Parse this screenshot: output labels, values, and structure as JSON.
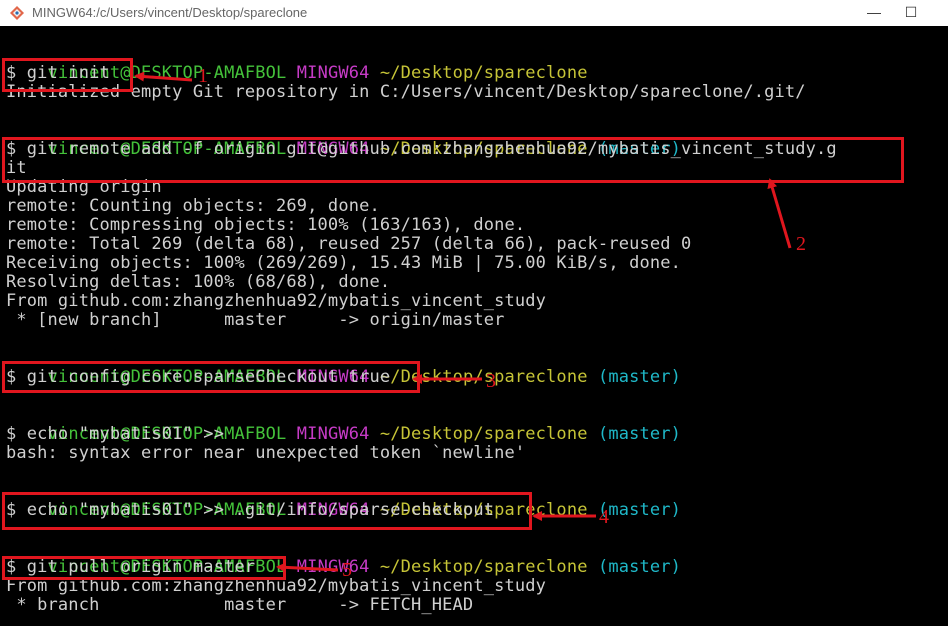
{
  "window": {
    "title": "MINGW64:/c/Users/vincent/Desktop/spareclone",
    "icon": "git-bash-icon",
    "minimize_glyph": "—",
    "maximize_glyph": "☐"
  },
  "colors": {
    "user": "#44c23a",
    "shell": "#c63bc6",
    "path": "#c6c437",
    "branch": "#1fb8c8",
    "text": "#d0d0d0",
    "annotation": "#e0161e"
  },
  "terminal": {
    "prompts": [
      {
        "user": "vincent@DESKTOP-AMAFBOL",
        "shell": "MINGW64",
        "path": "~/Desktop/spareclone",
        "branch": ""
      },
      {
        "user": "vincent@DESKTOP-AMAFBOL",
        "shell": "MINGW64",
        "path": "~/Desktop/spareclone",
        "branch": "(master)"
      },
      {
        "user": "vincent@DESKTOP-AMAFBOL",
        "shell": "MINGW64",
        "path": "~/Desktop/spareclone",
        "branch": "(master)"
      },
      {
        "user": "vincent@DESKTOP-AMAFBOL",
        "shell": "MINGW64",
        "path": "~/Desktop/spareclone",
        "branch": "(master)"
      },
      {
        "user": "vincent@DESKTOP-AMAFBOL",
        "shell": "MINGW64",
        "path": "~/Desktop/spareclone",
        "branch": "(master)"
      },
      {
        "user": "vincent@DESKTOP-AMAFBOL",
        "shell": "MINGW64",
        "path": "~/Desktop/spareclone",
        "branch": "(master)"
      }
    ],
    "commands": [
      "$ git init",
      "$ git remote add -f origin git@github.com:zhangzhenhua92/mybatis_vincent_study.g",
      "it",
      "$ git config core.sparseCheckout true",
      "$ echo \"mybatis01\" >>",
      "$ echo \"mybatis01\" >> .git/info/sparse-checkout",
      "$ git pull origin master"
    ],
    "outputs": [
      "Initialized empty Git repository in C:/Users/vincent/Desktop/spareclone/.git/",
      "Updating origin",
      "remote: Counting objects: 269, done.",
      "remote: Compressing objects: 100% (163/163), done.",
      "remote: Total 269 (delta 68), reused 257 (delta 66), pack-reused 0",
      "Receiving objects: 100% (269/269), 15.43 MiB | 75.00 KiB/s, done.",
      "Resolving deltas: 100% (68/68), done.",
      "From github.com:zhangzhenhua92/mybatis_vincent_study",
      " * [new branch]      master     -> origin/master",
      "bash: syntax error near unexpected token `newline'",
      "From github.com:zhangzhenhua92/mybatis_vincent_study",
      " * branch            master     -> FETCH_HEAD"
    ]
  },
  "annotations": [
    "1",
    "2",
    "3",
    "4",
    "5"
  ]
}
